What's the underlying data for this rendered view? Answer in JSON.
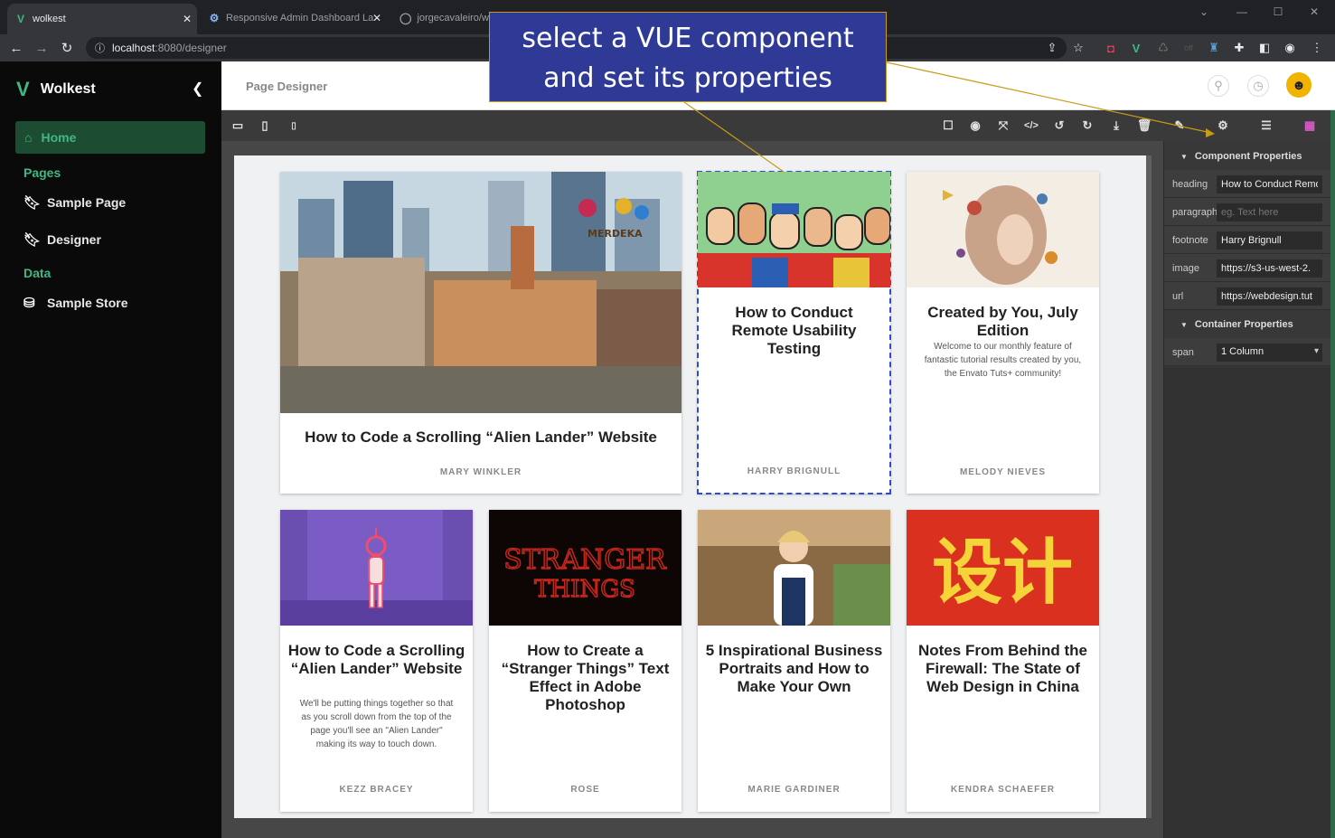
{
  "browser": {
    "tabs": [
      {
        "label": "wolkest",
        "active": true
      },
      {
        "label": "Responsive Admin Dashboard La",
        "active": false
      },
      {
        "label": "jorgecavaleiro/w",
        "active": false
      }
    ],
    "url_host": "localhost",
    "url_path": ":8080/designer"
  },
  "app": {
    "name": "Wolkest",
    "accent": "#41b883",
    "sidebar": {
      "home": "Home",
      "sections": [
        {
          "title": "Pages",
          "items": [
            "Sample Page",
            "Designer"
          ]
        },
        {
          "title": "Data",
          "items": [
            "Sample Store"
          ]
        }
      ]
    },
    "page_title": "Page Designer"
  },
  "annotation": {
    "line1": "select a VUE component",
    "line2": "and set its properties"
  },
  "cards": [
    {
      "heading": "How to Code a Scrolling “Alien Lander” Website",
      "paragraph": "",
      "footnote": "MARY WINKLER",
      "image": "city"
    },
    {
      "heading": "How to Conduct Remote Usability Testing",
      "paragraph": "",
      "footnote": "HARRY BRIGNULL",
      "image": "people",
      "selected": true
    },
    {
      "heading": "Created by You, July Edition",
      "paragraph": "Welcome to our monthly feature of fantastic tutorial results created by you, the Envato Tuts+ community!",
      "footnote": "MELODY NIEVES",
      "image": "art"
    },
    {
      "heading": "How to Code a Scrolling “Alien Lander” Website",
      "paragraph": "We'll be putting things together so that as you scroll down from the top of the page you'll see an \"Alien Lander\" making its way to touch down.",
      "footnote": "KEZZ BRACEY",
      "image": "alien"
    },
    {
      "heading": "How to Create a “Stranger Things” Text Effect in Adobe Photoshop",
      "paragraph": "",
      "footnote": "ROSE",
      "image": "stranger"
    },
    {
      "heading": "5 Inspirational Business Portraits and How to Make Your Own",
      "paragraph": "",
      "footnote": "MARIE GARDINER",
      "image": "portrait"
    },
    {
      "heading": "Notes From Behind the Firewall: The State of Web Design in China",
      "paragraph": "",
      "footnote": "KENDRA SCHAEFER",
      "image": "china"
    }
  ],
  "image_texts": {
    "stranger_line1": "STRANGER",
    "stranger_line2": "THINGS",
    "china": "设计",
    "merdeka": "MERDEKA"
  },
  "properties": {
    "component_title": "Component Properties",
    "fields": [
      {
        "label": "heading",
        "value": "How to Conduct Remote Usability Testing",
        "placeholder": ""
      },
      {
        "label": "paragraph",
        "value": "",
        "placeholder": "eg. Text here"
      },
      {
        "label": "footnote",
        "value": "Harry Brignull",
        "placeholder": ""
      },
      {
        "label": "image",
        "value": "https://s3-us-west-2.",
        "placeholder": ""
      },
      {
        "label": "url",
        "value": "https://webdesign.tut",
        "placeholder": ""
      }
    ],
    "container_title": "Container Properties",
    "span_label": "span",
    "span_value": "1 Column"
  }
}
